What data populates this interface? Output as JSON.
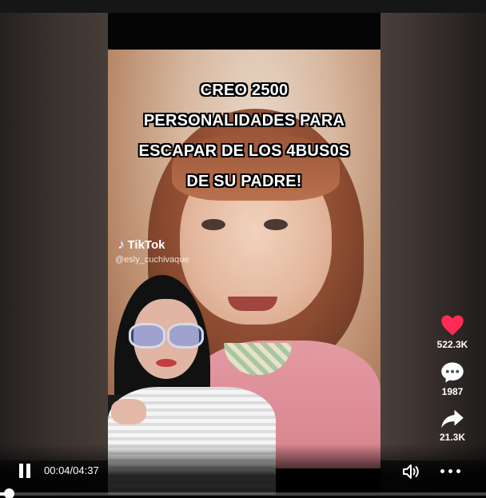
{
  "video": {
    "caption_lines": [
      "CREO 2500",
      "PERSONALIDADES PARA",
      "ESCAPAR DE LOS 4BUS0S",
      "DE SU PADRE!"
    ],
    "watermark": {
      "app_name": "TikTok",
      "username": "@esly_cuchivaque"
    }
  },
  "actions": {
    "like": {
      "icon": "heart-icon",
      "count": "522.3K",
      "color": "#fe2c55"
    },
    "comment": {
      "icon": "comment-icon",
      "count": "1987"
    },
    "share": {
      "icon": "share-icon",
      "count": "21.3K"
    }
  },
  "player": {
    "state_icon": "pause-icon",
    "time": "00:04/04:37",
    "volume_icon": "volume-icon",
    "more_icon": "more-icon",
    "progress_fraction": 0.014
  }
}
